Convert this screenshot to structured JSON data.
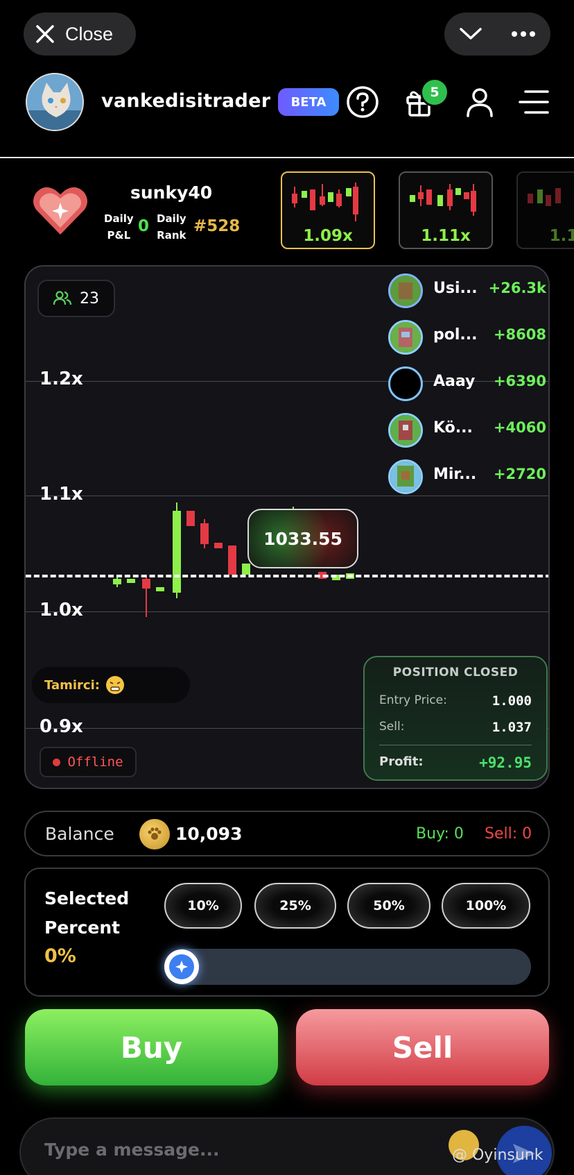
{
  "topbar": {
    "close_label": "Close"
  },
  "header": {
    "username": "vankedisitrader",
    "beta_label": "BETA",
    "gift_count": "5"
  },
  "player": {
    "name": "sunky40",
    "pnl_label_1": "Daily",
    "pnl_label_2": "P&L",
    "pnl_value": "0",
    "rank_label_1": "Daily",
    "rank_label_2": "Rank",
    "rank_value": "#528"
  },
  "rounds": [
    {
      "multiplier": "1.09x",
      "selected": true
    },
    {
      "multiplier": "1.11x",
      "selected": false
    },
    {
      "multiplier": "1.1",
      "selected": false
    }
  ],
  "chart": {
    "viewers": "23",
    "current_price": "1033.55",
    "y_labels": [
      "1.2x",
      "1.1x",
      "1.0x",
      "0.9x"
    ],
    "chat_user": "Tamirci:",
    "status": "Offline"
  },
  "leaderboard": [
    {
      "name": "Usi...",
      "score": "+26.3k"
    },
    {
      "name": "pol...",
      "score": "+8608"
    },
    {
      "name": "Aaay",
      "score": "+6390"
    },
    {
      "name": "Kö...",
      "score": "+4060"
    },
    {
      "name": "Mir...",
      "score": "+2720"
    }
  ],
  "position": {
    "title": "POSITION CLOSED",
    "entry_label": "Entry Price:",
    "entry_value": "1.000",
    "sell_label": "Sell:",
    "sell_value": "1.037",
    "profit_label": "Profit:",
    "profit_value": "+92.95"
  },
  "balance": {
    "label": "Balance",
    "value": "10,093",
    "buy": "Buy: 0",
    "sell": "Sell: 0"
  },
  "percent": {
    "title_1": "Selected",
    "title_2": "Percent",
    "value": "0%",
    "options": [
      "10%",
      "25%",
      "50%",
      "100%"
    ]
  },
  "actions": {
    "buy": "Buy",
    "sell": "Sell"
  },
  "message": {
    "placeholder": "Type a message...",
    "watermark": "@ Oyinsunk"
  },
  "colors": {
    "green": "#57e057",
    "red": "#e33a44",
    "gold": "#e8b84a",
    "accent_blue": "#3c7ff0"
  }
}
